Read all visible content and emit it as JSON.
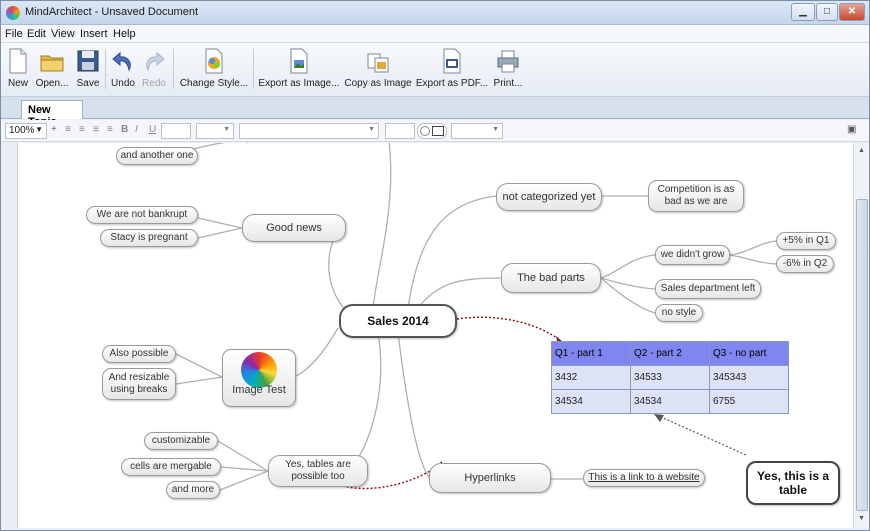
{
  "window": {
    "title": "MindArchitect - Unsaved Document"
  },
  "menu": [
    "File",
    "Edit",
    "View",
    "Insert",
    "Help"
  ],
  "toolbar": {
    "new": "New",
    "open": "Open...",
    "save": "Save",
    "undo": "Undo",
    "redo": "Redo",
    "change_style": "Change Style...",
    "export_image": "Export as Image...",
    "copy_image": "Copy as Image",
    "export_pdf": "Export as PDF...",
    "print": "Print..."
  },
  "tab": {
    "label": "New Topic"
  },
  "format": {
    "zoom": "100%",
    "bold": "B",
    "italic": "I",
    "underline": "U"
  },
  "mindmap": {
    "center": "Sales 2014",
    "nodes": {
      "and_another": "and another one",
      "good_news": "Good news",
      "not_bankrupt": "We are not bankrupt",
      "stacy": "Stacy is pregnant",
      "not_categorized": "not categorized yet",
      "competition": "Competition is as bad as we are",
      "bad_parts": "The bad parts",
      "didnt_grow": "we didn't grow",
      "plus5": "+5% in Q1",
      "minus6": "-6% in Q2",
      "sales_left": "Sales department left",
      "no_style": "no style",
      "also_possible": "Also possible",
      "resizable": "And resizable using breaks",
      "image_test": "Image Test",
      "customizable": "customizable",
      "mergable": "cells are mergable",
      "and_more": "and more",
      "tables_possible": "Yes, tables are possible too",
      "hyperlinks": "Hyperlinks",
      "website_link": "This is a link to a website",
      "note_table": "Yes, this is a table"
    },
    "table": {
      "headers": [
        "Q1 - part 1",
        "Q2 - part 2",
        "Q3 - no part"
      ],
      "rows": [
        [
          "3432",
          "34533",
          "345343"
        ],
        [
          "34534",
          "34534",
          "6755"
        ]
      ]
    }
  },
  "colors": {
    "accent_link": "#8b1a1a",
    "table_header": "#7f86f0",
    "table_cell": "#dde2f7"
  }
}
